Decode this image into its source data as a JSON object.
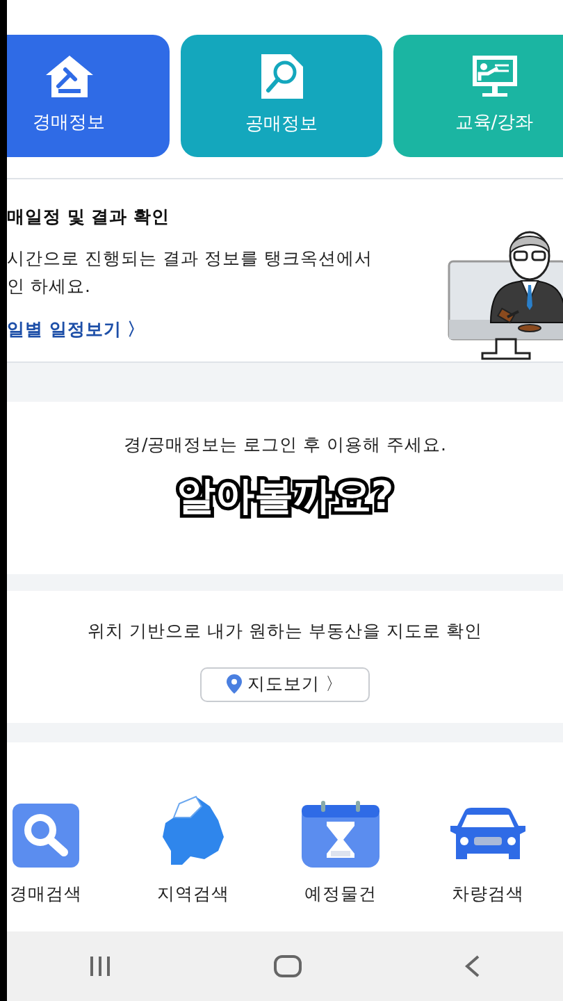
{
  "tiles": [
    {
      "label": "경매정보",
      "kind": "auction",
      "color": "#2f6be6"
    },
    {
      "label": "공매정보",
      "kind": "public",
      "color": "#14a7bd"
    },
    {
      "label": "교육/강좌",
      "kind": "education",
      "color": "#1bb5a2"
    }
  ],
  "schedule": {
    "title": "매일정 및 결과 확인",
    "lines": [
      "시간으로 진행되는 결과 정보를 탱크옥션에서",
      "인 하세요."
    ],
    "link": "일별 일정보기 〉"
  },
  "login_notice": "경/공매정보는 로그인 후 이용해 주세요.",
  "caption": "알아볼까요?",
  "map": {
    "text": "위치 기반으로 내가 원하는 부동산을 지도로 확인",
    "button": "지도보기 〉"
  },
  "shortcuts": [
    {
      "label": "경매검색",
      "kind": "search"
    },
    {
      "label": "지역검색",
      "kind": "region"
    },
    {
      "label": "예정물건",
      "kind": "calendar"
    },
    {
      "label": "차량검색",
      "kind": "car"
    }
  ],
  "nav_buttons": [
    {
      "kind": "recent"
    },
    {
      "kind": "home"
    },
    {
      "kind": "back"
    }
  ]
}
